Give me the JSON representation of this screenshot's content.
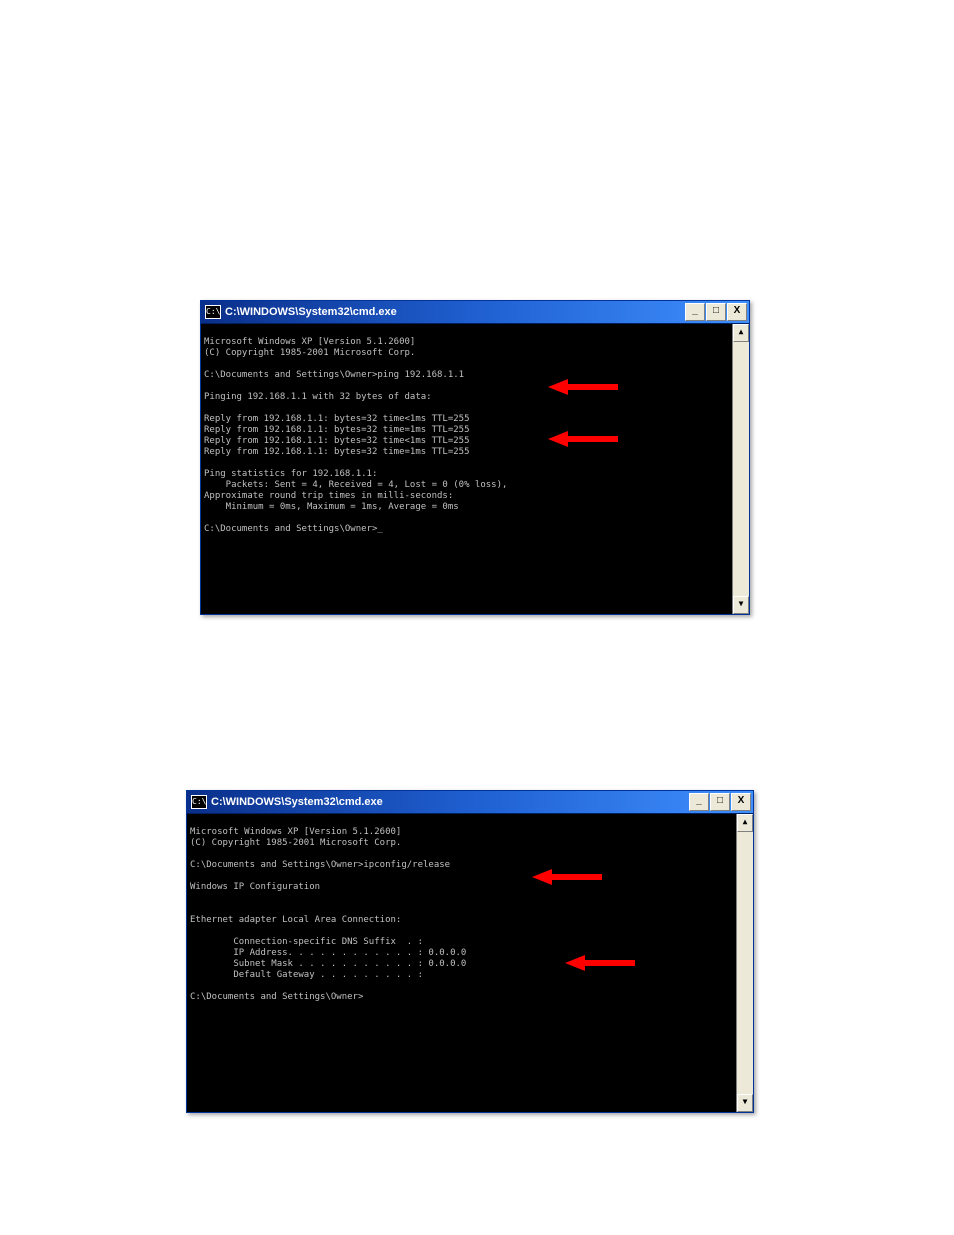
{
  "win1": {
    "title": "C:\\WINDOWS\\System32\\cmd.exe",
    "icon_glyph": "C:\\",
    "btn_min": "_",
    "btn_max": "□",
    "btn_close": "X",
    "scroll_up": "▲",
    "scroll_down": "▼",
    "lines": {
      "l0": "Microsoft Windows XP [Version 5.1.2600]",
      "l1": "(C) Copyright 1985-2001 Microsoft Corp.",
      "l2": "",
      "l3": "C:\\Documents and Settings\\Owner>ping 192.168.1.1",
      "l4": "",
      "l5": "Pinging 192.168.1.1 with 32 bytes of data:",
      "l6": "",
      "l7": "Reply from 192.168.1.1: bytes=32 time<1ms TTL=255",
      "l8": "Reply from 192.168.1.1: bytes=32 time=1ms TTL=255",
      "l9": "Reply from 192.168.1.1: bytes=32 time<1ms TTL=255",
      "l10": "Reply from 192.168.1.1: bytes=32 time=1ms TTL=255",
      "l11": "",
      "l12": "Ping statistics for 192.168.1.1:",
      "l13": "    Packets: Sent = 4, Received = 4, Lost = 0 (0% loss),",
      "l14": "Approximate round trip times in milli-seconds:",
      "l15": "    Minimum = 0ms, Maximum = 1ms, Average = 0ms",
      "l16": "",
      "l17": "C:\\Documents and Settings\\Owner>_"
    }
  },
  "win2": {
    "title": "C:\\WINDOWS\\System32\\cmd.exe",
    "icon_glyph": "C:\\",
    "btn_min": "_",
    "btn_max": "□",
    "btn_close": "X",
    "scroll_up": "▲",
    "scroll_down": "▼",
    "lines": {
      "l0": "Microsoft Windows XP [Version 5.1.2600]",
      "l1": "(C) Copyright 1985-2001 Microsoft Corp.",
      "l2": "",
      "l3": "C:\\Documents and Settings\\Owner>ipconfig/release",
      "l4": "",
      "l5": "Windows IP Configuration",
      "l6": "",
      "l7": "",
      "l8": "Ethernet adapter Local Area Connection:",
      "l9": "",
      "l10": "        Connection-specific DNS Suffix  . :",
      "l11": "        IP Address. . . . . . . . . . . . : 0.0.0.0",
      "l12": "        Subnet Mask . . . . . . . . . . . : 0.0.0.0",
      "l13": "        Default Gateway . . . . . . . . . :",
      "l14": "",
      "l15": "C:\\Documents and Settings\\Owner>"
    }
  },
  "arrow_color": "#ff0000"
}
